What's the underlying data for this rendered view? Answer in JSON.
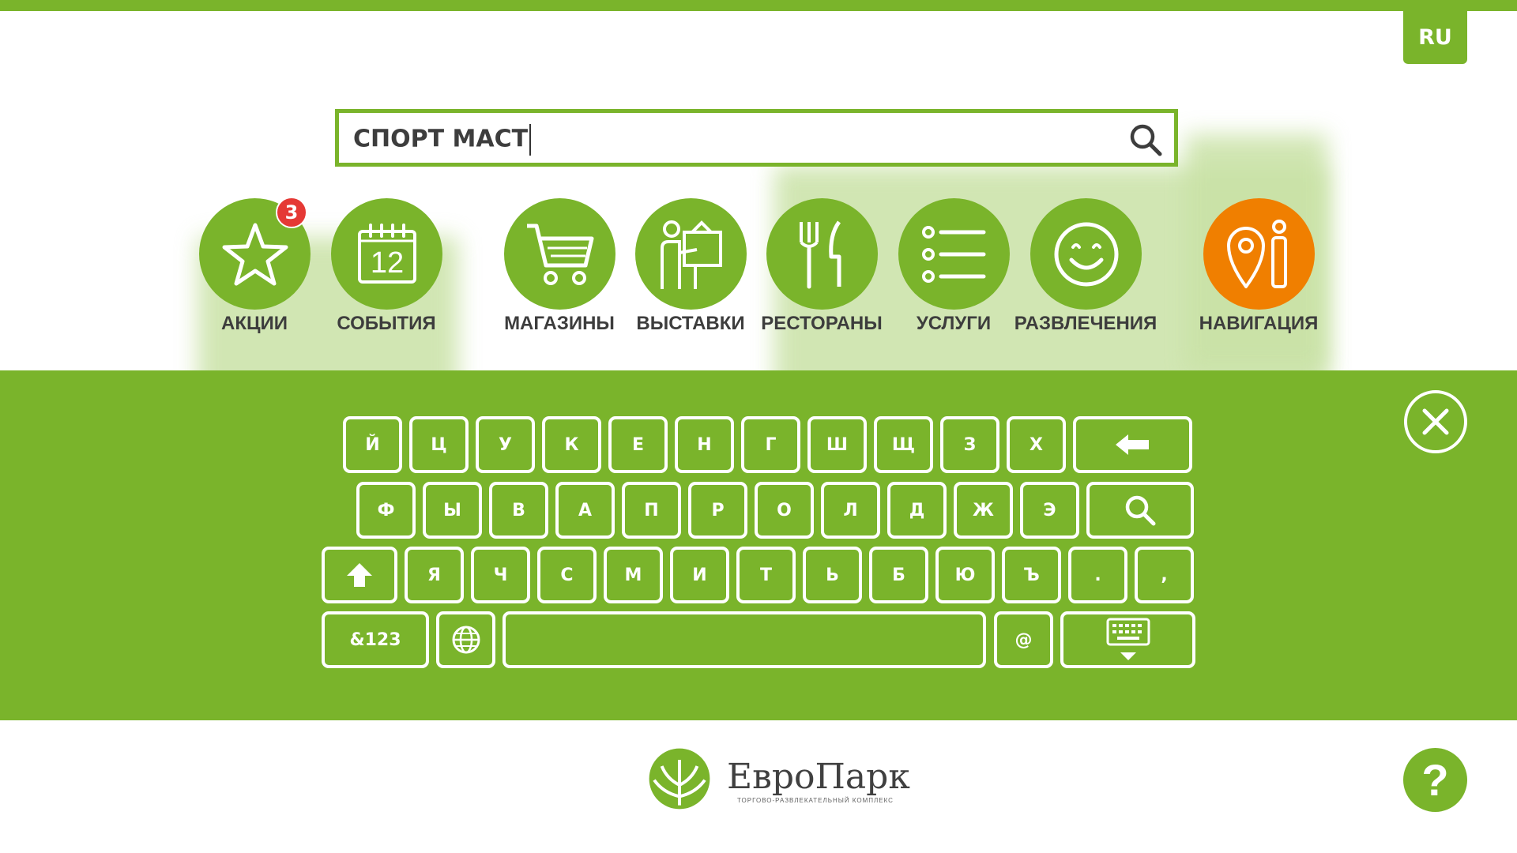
{
  "app": {
    "language": "RU",
    "accent_color": "#7ab42b",
    "highlight_color": "#f07f00"
  },
  "search": {
    "value": "СПОРТ МАСТ",
    "icon": "search-icon"
  },
  "categories": [
    {
      "label": "АКЦИИ",
      "icon": "star-icon",
      "badge": "3",
      "active": false
    },
    {
      "label": "СОБЫТИЯ",
      "icon": "calendar-icon",
      "calendar_day": "12",
      "active": false
    },
    {
      "label": "МАГАЗИНЫ",
      "icon": "cart-icon",
      "active": false
    },
    {
      "label": "ВЫСТАВКИ",
      "icon": "exhibition-icon",
      "active": false
    },
    {
      "label": "РЕСТОРАНЫ",
      "icon": "fork-knife-icon",
      "active": false
    },
    {
      "label": "УСЛУГИ",
      "icon": "list-icon",
      "active": false
    },
    {
      "label": "РАЗВЛЕЧЕНИЯ",
      "icon": "smile-icon",
      "active": false
    },
    {
      "label": "НАВИГАЦИЯ",
      "icon": "map-pin-person-icon",
      "active": true
    }
  ],
  "keyboard": {
    "row1": [
      "Й",
      "Ц",
      "У",
      "К",
      "Е",
      "Н",
      "Г",
      "Ш",
      "Щ",
      "З",
      "Х"
    ],
    "row2": [
      "Ф",
      "Ы",
      "В",
      "А",
      "П",
      "Р",
      "О",
      "Л",
      "Д",
      "Ж",
      "Э"
    ],
    "row3": [
      "Я",
      "Ч",
      "С",
      "М",
      "И",
      "Т",
      "Ь",
      "Б",
      "Ю",
      "Ъ",
      ".",
      ","
    ],
    "symbols_label": "&123",
    "at_label": "@",
    "backspace_icon": "backspace-arrow-icon",
    "search_icon": "search-icon",
    "shift_icon": "shift-arrow-icon",
    "globe_icon": "globe-icon",
    "hide_icon": "keyboard-hide-icon",
    "close_icon": "close-icon"
  },
  "footer": {
    "brand": "ЕвроПарк",
    "tagline": "ТОРГОВО-РАЗВЛЕКАТЕЛЬНЫЙ КОМПЛЕКС",
    "help_label": "?"
  }
}
